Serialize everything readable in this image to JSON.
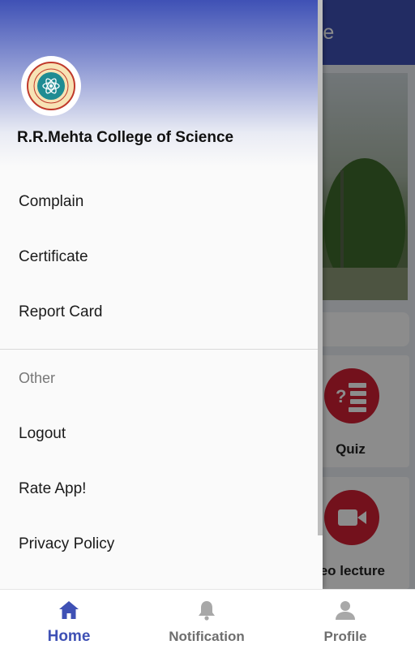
{
  "background_app": {
    "title_fragment": "nce",
    "tiles": [
      {
        "label": "Quiz",
        "icon": "quiz-list-icon"
      },
      {
        "label": "leo lecture",
        "icon": "video-camera-icon"
      }
    ]
  },
  "drawer": {
    "college_name": "R.R.Mehta College of Science",
    "logo": "college-seal-logo",
    "menu_items": [
      {
        "label": "Complain"
      },
      {
        "label": "Certificate"
      },
      {
        "label": "Report Card"
      }
    ],
    "section_other": "Other",
    "other_items": [
      {
        "label": "Logout"
      },
      {
        "label": "Rate App!"
      },
      {
        "label": "Privacy Policy"
      }
    ]
  },
  "bottom_nav": {
    "active": "Home",
    "items": [
      {
        "label": "Home",
        "icon": "home-icon"
      },
      {
        "label": "Notification",
        "icon": "bell-icon"
      },
      {
        "label": "Profile",
        "icon": "person-icon"
      }
    ]
  },
  "colors": {
    "primary": "#3f51b5",
    "accent_red": "#d11f34",
    "logo_teal": "#1f8c93"
  }
}
